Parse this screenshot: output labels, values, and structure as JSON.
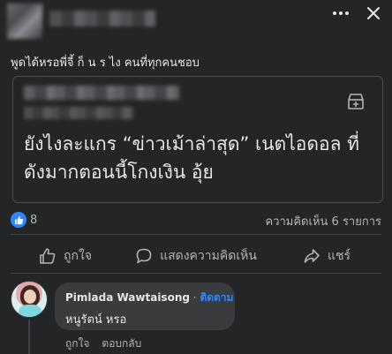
{
  "post": {
    "caption": "พูดได้หรอพี่จี้ ก็ น ร ไง คนที่ทุกคนชอบ",
    "card_text": "ยังไงละแกร “ข่าวเม้าล่าสุด” เนตไอดอล ที่ดังมากตอนนี้โกงเงิน อุ้ย",
    "reaction_count": "8",
    "comments_count": "ความคิดเห็น 6 รายการ"
  },
  "actions": {
    "like": "ถูกใจ",
    "comment": "แสดงความคิดเห็น",
    "share": "แชร์"
  },
  "comment": {
    "author": "Pimlada Wawtaisong",
    "separator": "·",
    "follow": "ติดตาม",
    "text": "หนูรัตน์ หรอ",
    "like": "ถูกใจ",
    "reply": "ตอบกลับ"
  },
  "colors": {
    "background": "#242526",
    "text": "#e4e6eb",
    "muted": "#b0b3b8",
    "accent": "#2d88ff",
    "bubble": "#3a3b3c"
  },
  "icons": {
    "more": "more-horizontal-icon",
    "close": "close-icon",
    "save": "save-inbox-icon",
    "like_reaction": "thumbs-up-icon",
    "like_action": "thumbs-up-outline-icon",
    "comment_action": "speech-bubble-icon",
    "share_action": "share-arrow-icon"
  }
}
